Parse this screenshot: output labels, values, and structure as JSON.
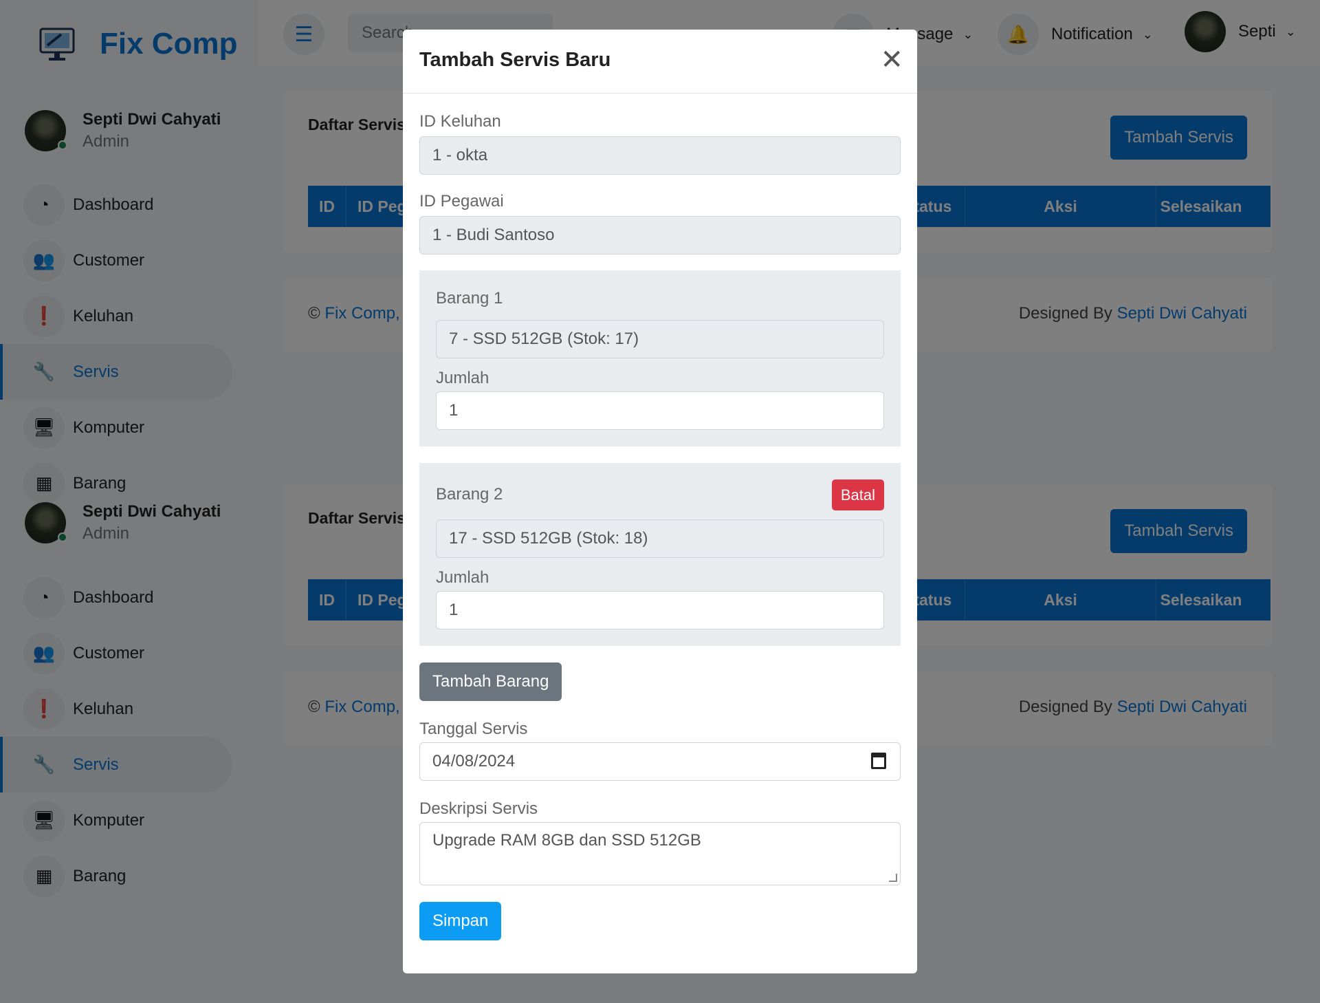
{
  "brand": {
    "name": "Fix Comp"
  },
  "sidebar": {
    "user": {
      "name": "Septi Dwi Cahyati",
      "role": "Admin"
    },
    "items": [
      {
        "label": "Dashboard",
        "icon": "speedometer-icon"
      },
      {
        "label": "Customer",
        "icon": "users-icon"
      },
      {
        "label": "Keluhan",
        "icon": "exclamation-icon"
      },
      {
        "label": "Servis",
        "icon": "wrench-icon",
        "active": true
      },
      {
        "label": "Komputer",
        "icon": "monitor-icon"
      },
      {
        "label": "Barang",
        "icon": "boxes-icon"
      }
    ]
  },
  "topbar": {
    "search_placeholder": "Search",
    "message_label": "Message",
    "notification_label": "Notification",
    "user_label": "Septi"
  },
  "content": {
    "card_title": "Daftar Servis",
    "add_button": "Tambah Servis",
    "columns": [
      "ID",
      "ID Pegawai",
      "Status",
      "Aksi",
      "Selesaikan"
    ],
    "footer_copyright": "©",
    "footer_brand": "Fix Comp, All Right Reserved.",
    "footer_designed": "Designed By",
    "footer_author": "Septi Dwi Cahyati"
  },
  "modal": {
    "title": "Tambah Servis Baru",
    "id_keluhan_label": "ID Keluhan",
    "id_keluhan_value": "1 - okta",
    "id_pegawai_label": "ID Pegawai",
    "id_pegawai_value": "1 - Budi Santoso",
    "items": [
      {
        "label": "Barang 1",
        "barang": "7 - SSD 512GB (Stok: 17)",
        "jumlah_label": "Jumlah",
        "jumlah": "1"
      },
      {
        "label": "Barang 2",
        "barang": "17 - SSD 512GB (Stok: 18)",
        "jumlah_label": "Jumlah",
        "jumlah": "1",
        "cancel": "Batal"
      }
    ],
    "add_item_button": "Tambah Barang",
    "tanggal_label": "Tanggal Servis",
    "tanggal_value": "04/08/2024",
    "deskripsi_label": "Deskripsi Servis",
    "deskripsi_value": "Upgrade RAM 8GB dan SSD 512GB",
    "save_button": "Simpan"
  }
}
